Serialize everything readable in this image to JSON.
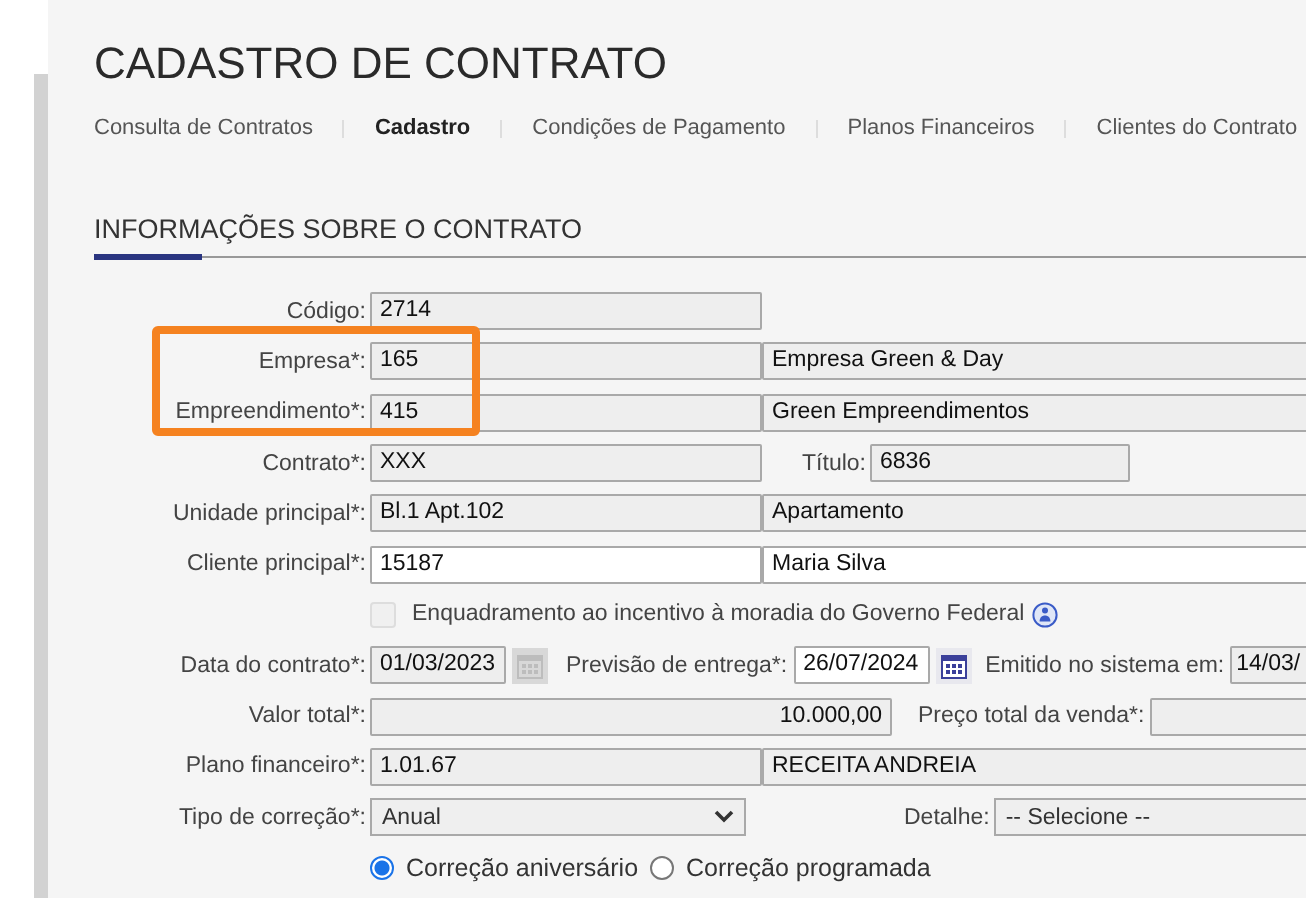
{
  "title": "CADASTRO DE CONTRATO",
  "tabs": [
    {
      "label": "Consulta de Contratos",
      "selected": false
    },
    {
      "label": "Cadastro",
      "selected": true
    },
    {
      "label": "Condições de Pagamento",
      "selected": false
    },
    {
      "label": "Planos Financeiros",
      "selected": false
    },
    {
      "label": "Clientes do Contrato",
      "selected": false
    }
  ],
  "section": "INFORMAÇÕES SOBRE O CONTRATO",
  "codigo": {
    "label": "Código:",
    "field": {
      "value": "2714",
      "disabled": true
    }
  },
  "empresa": {
    "label": "Empresa*:",
    "code": {
      "value": "165",
      "disabled": true
    },
    "name": {
      "value": "Empresa Green & Day",
      "disabled": true
    }
  },
  "empreendimento": {
    "label": "Empreendimento*:",
    "code": {
      "value": "415",
      "disabled": true
    },
    "name": {
      "value": "Green Empreendimentos",
      "disabled": true
    }
  },
  "contrato": {
    "label": "Contrato*:",
    "field": {
      "value": "XXX",
      "disabled": true
    },
    "titulo_label": "Título:",
    "titulo": {
      "value": "6836",
      "disabled": true
    }
  },
  "unidade": {
    "label": "Unidade principal*:",
    "code": {
      "value": "Bl.1 Apt.102",
      "disabled": true
    },
    "name": {
      "value": "Apartamento",
      "disabled": true
    }
  },
  "cliente": {
    "label": "Cliente principal*:",
    "code": {
      "value": "15187",
      "disabled": false
    },
    "name": {
      "value": "Maria Silva",
      "disabled": false
    }
  },
  "incentivo": {
    "label": "Enquadramento ao incentivo à moradia do Governo Federal",
    "checked": false,
    "disabled": true
  },
  "datas": {
    "label": "Data do contrato*:",
    "contrato": {
      "value": "01/03/2023",
      "disabled": true
    },
    "entrega_label": "Previsão de entrega*:",
    "entrega": {
      "value": "26/07/2024",
      "disabled": false
    },
    "emitido_label": "Emitido no sistema em:",
    "emitido": {
      "value": "14/03/",
      "disabled": true
    }
  },
  "valor": {
    "label": "Valor total*:",
    "field": {
      "value": "10.000,00",
      "disabled": true
    },
    "preco_label": "Preço total da venda*:",
    "preco": {
      "disabled": true
    }
  },
  "plano": {
    "label": "Plano financeiro*:",
    "code": {
      "value": "1.01.67",
      "disabled": true
    },
    "name": {
      "value": "RECEITA ANDREIA",
      "disabled": true
    }
  },
  "correcao": {
    "label": "Tipo de correção*:",
    "value": "Anual",
    "detalhe_label": "Detalhe:",
    "detalhe": "-- Selecione --"
  },
  "radios": [
    {
      "label": "Correção aniversário",
      "selected": true
    },
    {
      "label": "Correção programada",
      "selected": false
    }
  ]
}
